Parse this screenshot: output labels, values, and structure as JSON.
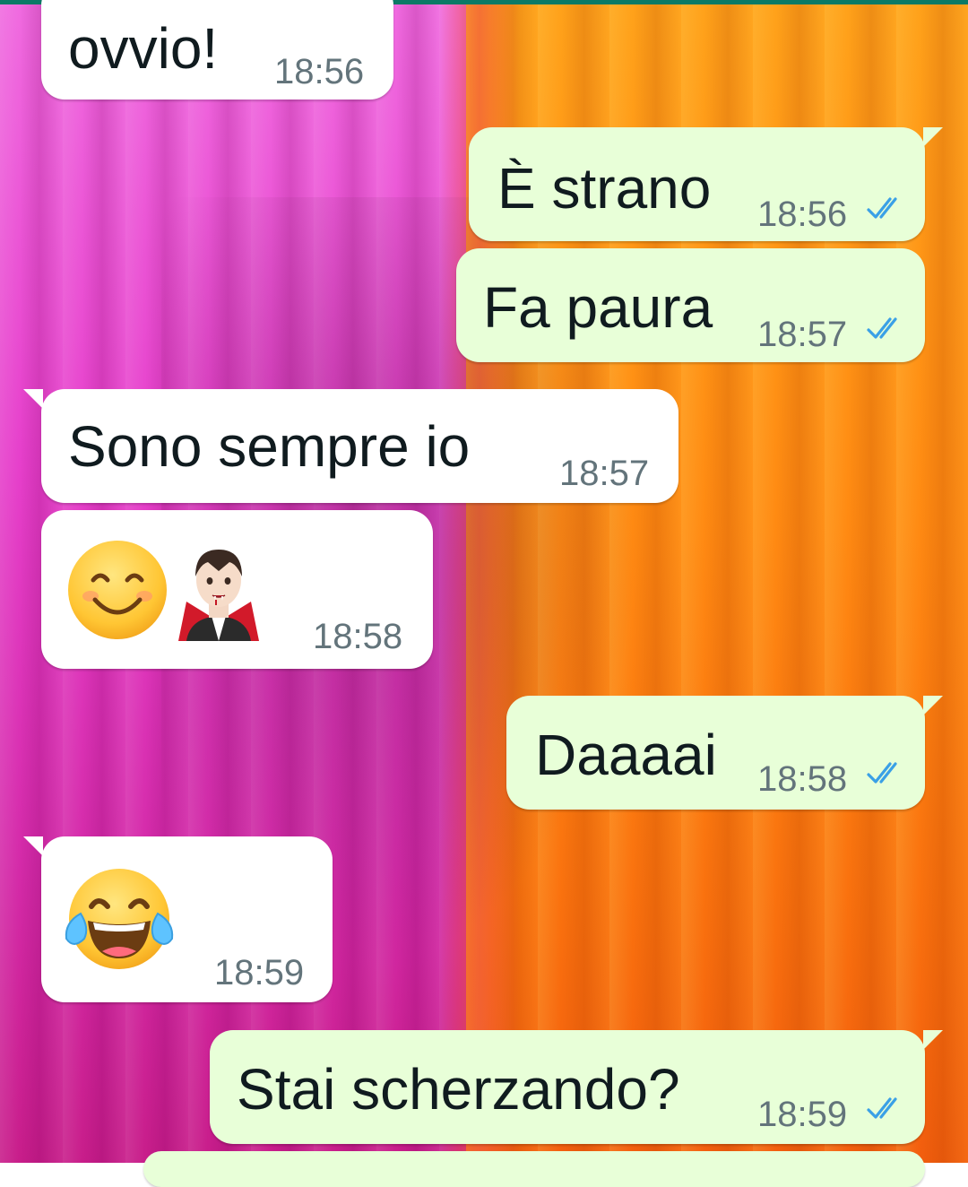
{
  "colors": {
    "incoming_bubble": "#ffffff",
    "outgoing_bubble": "#e8ffd8",
    "timestamp": "#63747b",
    "read_ticks": "#3aa0e6",
    "top_bar": "#0b7a66"
  },
  "messages": [
    {
      "direction": "incoming",
      "text": "ovvio!",
      "time": "18:56"
    },
    {
      "direction": "outgoing",
      "text": "È strano",
      "time": "18:56",
      "status": "read",
      "status_icon": "double-check-icon"
    },
    {
      "direction": "outgoing",
      "text": "Fa paura",
      "time": "18:57",
      "status": "read",
      "status_icon": "double-check-icon"
    },
    {
      "direction": "incoming",
      "text": "Sono sempre io",
      "time": "18:57"
    },
    {
      "direction": "incoming",
      "emojis": [
        "smiling-face-icon",
        "vampire-icon"
      ],
      "time": "18:58"
    },
    {
      "direction": "outgoing",
      "text": "Daaaai",
      "time": "18:58",
      "status": "read",
      "status_icon": "double-check-icon"
    },
    {
      "direction": "incoming",
      "emojis": [
        "tears-of-joy-icon"
      ],
      "time": "18:59"
    },
    {
      "direction": "outgoing",
      "text": "Stai scherzando?",
      "time": "18:59",
      "status": "read",
      "status_icon": "double-check-icon"
    }
  ]
}
